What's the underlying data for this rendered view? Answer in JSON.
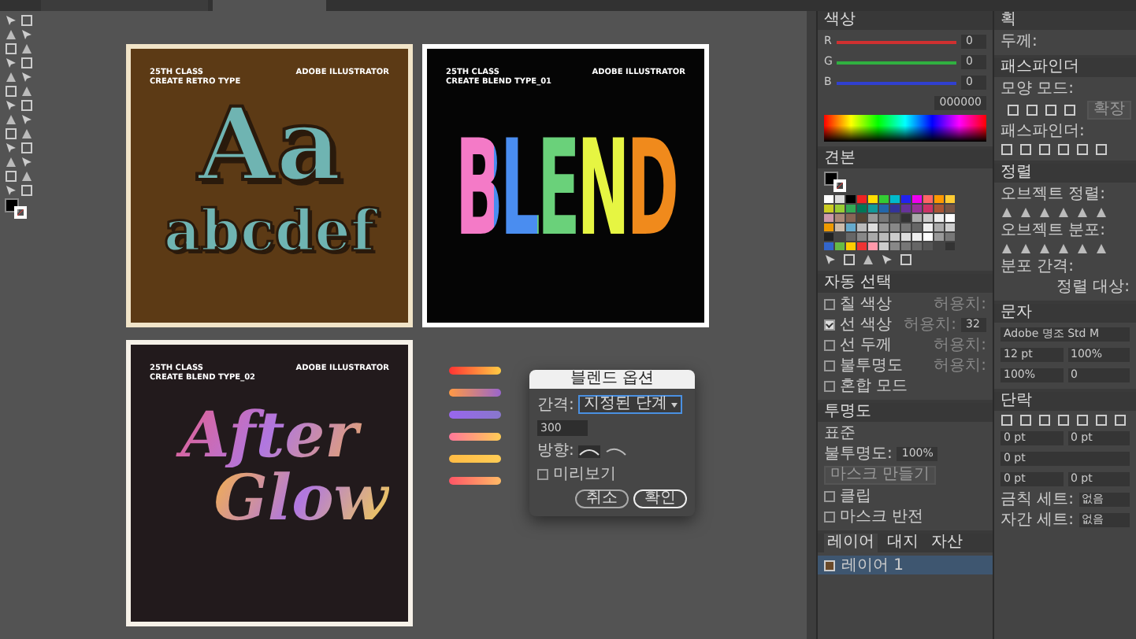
{
  "tabs": [
    {
      "selected": false
    },
    {
      "selected": true
    }
  ],
  "artboards": [
    {
      "kind": "retro",
      "class": "25TH CLASS",
      "subtitle": "CREATE RETRO TYPE",
      "brand": "ADOBE ILLUSTRATOR",
      "headline": "Aa",
      "subline": "abcdef"
    },
    {
      "kind": "blend",
      "class": "25TH CLASS",
      "subtitle": "CREATE BLEND TYPE_01",
      "brand": "ADOBE ILLUSTRATOR",
      "headline": "BLEND"
    },
    {
      "kind": "glow",
      "class": "25TH CLASS",
      "subtitle": "CREATE BLEND TYPE_02",
      "brand": "ADOBE ILLUSTRATOR",
      "headline": "After",
      "subline": "Glow"
    }
  ],
  "dialog": {
    "title": "블렌드 옵션",
    "spacing_label": "간격:",
    "spacing_value": "지정된 단계",
    "steps": "300",
    "orientation_label": "방향:",
    "preview": {
      "label": "미리보기",
      "checked": false
    },
    "buttons": [
      {
        "label": "취소",
        "kind": "secondary"
      },
      {
        "label": "확인",
        "kind": "primary"
      }
    ]
  },
  "color_panel": {
    "title": "색상",
    "channels": [
      {
        "name": "R",
        "value": "0",
        "color": "#d03030"
      },
      {
        "name": "G",
        "value": "0",
        "color": "#30b040"
      },
      {
        "name": "B",
        "value": "0",
        "color": "#3040d0"
      }
    ],
    "hex": "000000"
  },
  "swatches_panel": {
    "title": "견본"
  },
  "select_panel": {
    "title": "자동 선택",
    "rows": [
      {
        "label": "칠 색상",
        "checked": false,
        "tolerance_label": "허용치:"
      },
      {
        "label": "선 색상",
        "checked": true,
        "tolerance_label": "허용치:",
        "value": "32"
      },
      {
        "label": "선 두께",
        "checked": false,
        "tolerance_label": "허용치:"
      },
      {
        "label": "불투명도",
        "checked": false,
        "tolerance_label": "허용치:"
      },
      {
        "label": "혼합 모드",
        "checked": false
      }
    ]
  },
  "transparency_panel": {
    "title": "투명도",
    "mode": "표준",
    "opacity_label": "불투명도:",
    "opacity": "100%",
    "mask_button": "마스크 만들기",
    "options": [
      {
        "label": "클립",
        "checked": false
      },
      {
        "label": "마스크 반전",
        "checked": false
      }
    ]
  },
  "layers_panel": {
    "tabs": [
      {
        "label": "레이어",
        "selected": true
      },
      {
        "label": "대지",
        "selected": false
      },
      {
        "label": "자산",
        "selected": false
      }
    ],
    "layers": [
      {
        "name": "레이어 1",
        "selected": true
      }
    ]
  },
  "stroke_panel": {
    "title": "획",
    "weight_label": "두께:"
  },
  "pathfinder_panel": {
    "title": "패스파인더",
    "shape_modes": "모양 모드:",
    "expand": "확장",
    "pathfinders": "패스파인더:"
  },
  "align_panel": {
    "title": "정렬",
    "sections": [
      "오브젝트 정렬:",
      "오브젝트 분포:",
      "분포 간격:"
    ],
    "align_to": "정렬 대상:"
  },
  "character_panel": {
    "title": "문자",
    "font": "Adobe 명조 Std M",
    "fields": [
      "12 pt",
      "100%",
      "100%",
      "0"
    ]
  },
  "paragraph_panel": {
    "title": "단락",
    "fields": [
      "0 pt",
      "0 pt",
      "0 pt",
      "0 pt",
      "0 pt"
    ],
    "options": [
      {
        "label": "금칙 세트:",
        "value": "없음"
      },
      {
        "label": "자간 세트:",
        "value": "없음"
      }
    ]
  }
}
